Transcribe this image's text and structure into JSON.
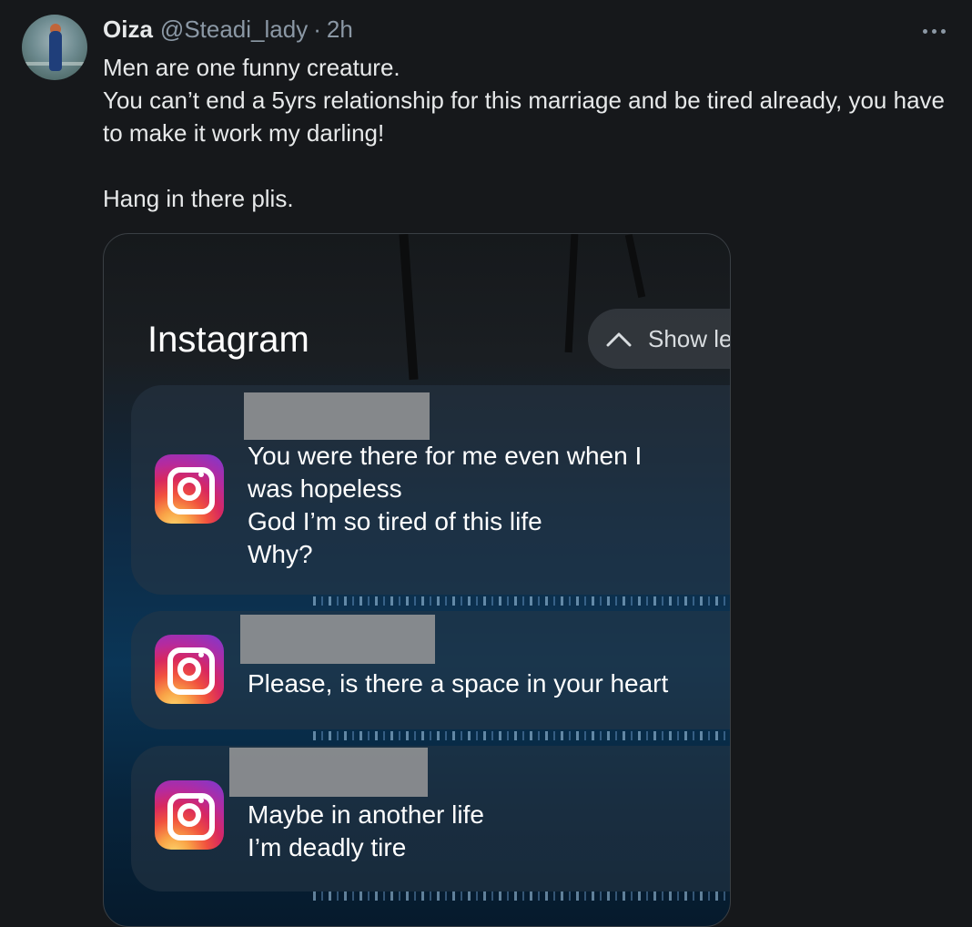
{
  "tweet": {
    "author_name": "Oiza",
    "author_handle": "@Steadi_lady",
    "separator": "·",
    "time": "2h",
    "text_lines": [
      "Men are one funny creature.",
      "You can’t end a 5yrs relationship for this marriage and be tired already, you have to make it work my darling!",
      "",
      "Hang in there plis."
    ]
  },
  "media": {
    "app_name": "Instagram",
    "show_less_label": "Show le",
    "notifications": [
      {
        "lines": [
          "You were there for me even when I",
          "was hopeless",
          "God I’m so tired of this life",
          "Why?"
        ]
      },
      {
        "lines": [
          "Please, is there a space in your heart"
        ]
      },
      {
        "lines": [
          "Maybe in another life",
          "I’m deadly tire"
        ]
      }
    ]
  },
  "colors": {
    "background": "#16181b",
    "text_primary": "#e7e9ea",
    "text_secondary": "#8b98a5"
  },
  "icons": [
    "more-icon",
    "chevron-up-icon",
    "instagram-icon"
  ]
}
